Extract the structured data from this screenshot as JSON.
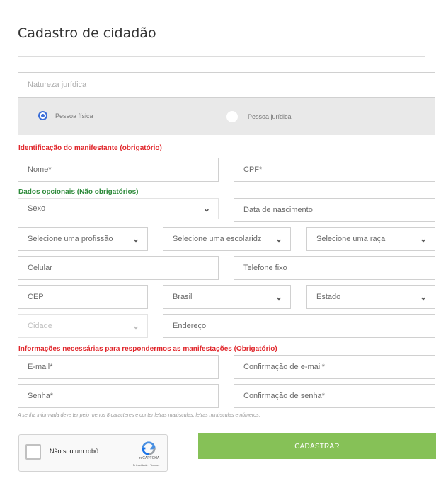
{
  "page": {
    "title": "Cadastro de cidadão",
    "natureza_placeholder": "Natureza jurídica",
    "radio_fisica": "Pessoa física",
    "radio_juridica": "Pessoa jurídica"
  },
  "sections": {
    "identificacao": "Identificação do manifestante (obrigatório)",
    "opcionais": "Dados opcionais (Não obrigatórios)",
    "informacoes": "Informações necessárias para respondermos as manifestações (Obrigatório)"
  },
  "fields": {
    "nome": "Nome*",
    "cpf": "CPF*",
    "sexo": "Sexo",
    "data_nascimento": "Data de nascimento",
    "profissao": "Selecione uma profissão",
    "escolaridade": "Selecione uma escolaridz",
    "raca": "Selecione uma raça",
    "celular": "Celular",
    "telefone": "Telefone fixo",
    "cep": "CEP",
    "pais": "Brasil",
    "estado": "Estado",
    "cidade": "Cidade",
    "endereco": "Endereço",
    "email": "E-mail*",
    "confirm_email": "Confirmação de e-mail*",
    "senha": "Senha*",
    "confirm_senha": "Confirmação de senha*"
  },
  "note": "A senha informada deve ter pelo menos 8 caracteres e conter letras maiúsculas, letras minúsculas e números.",
  "captcha": {
    "label": "Não sou um robô",
    "brand": "reCAPTCHA",
    "terms": "Privacidade - Termos"
  },
  "submit": "CADASTRAR",
  "colors": {
    "error_red": "#e0262b",
    "optional_green": "#2d8a3a",
    "button_green": "#86c157",
    "radio_blue": "#3b6ed8"
  }
}
